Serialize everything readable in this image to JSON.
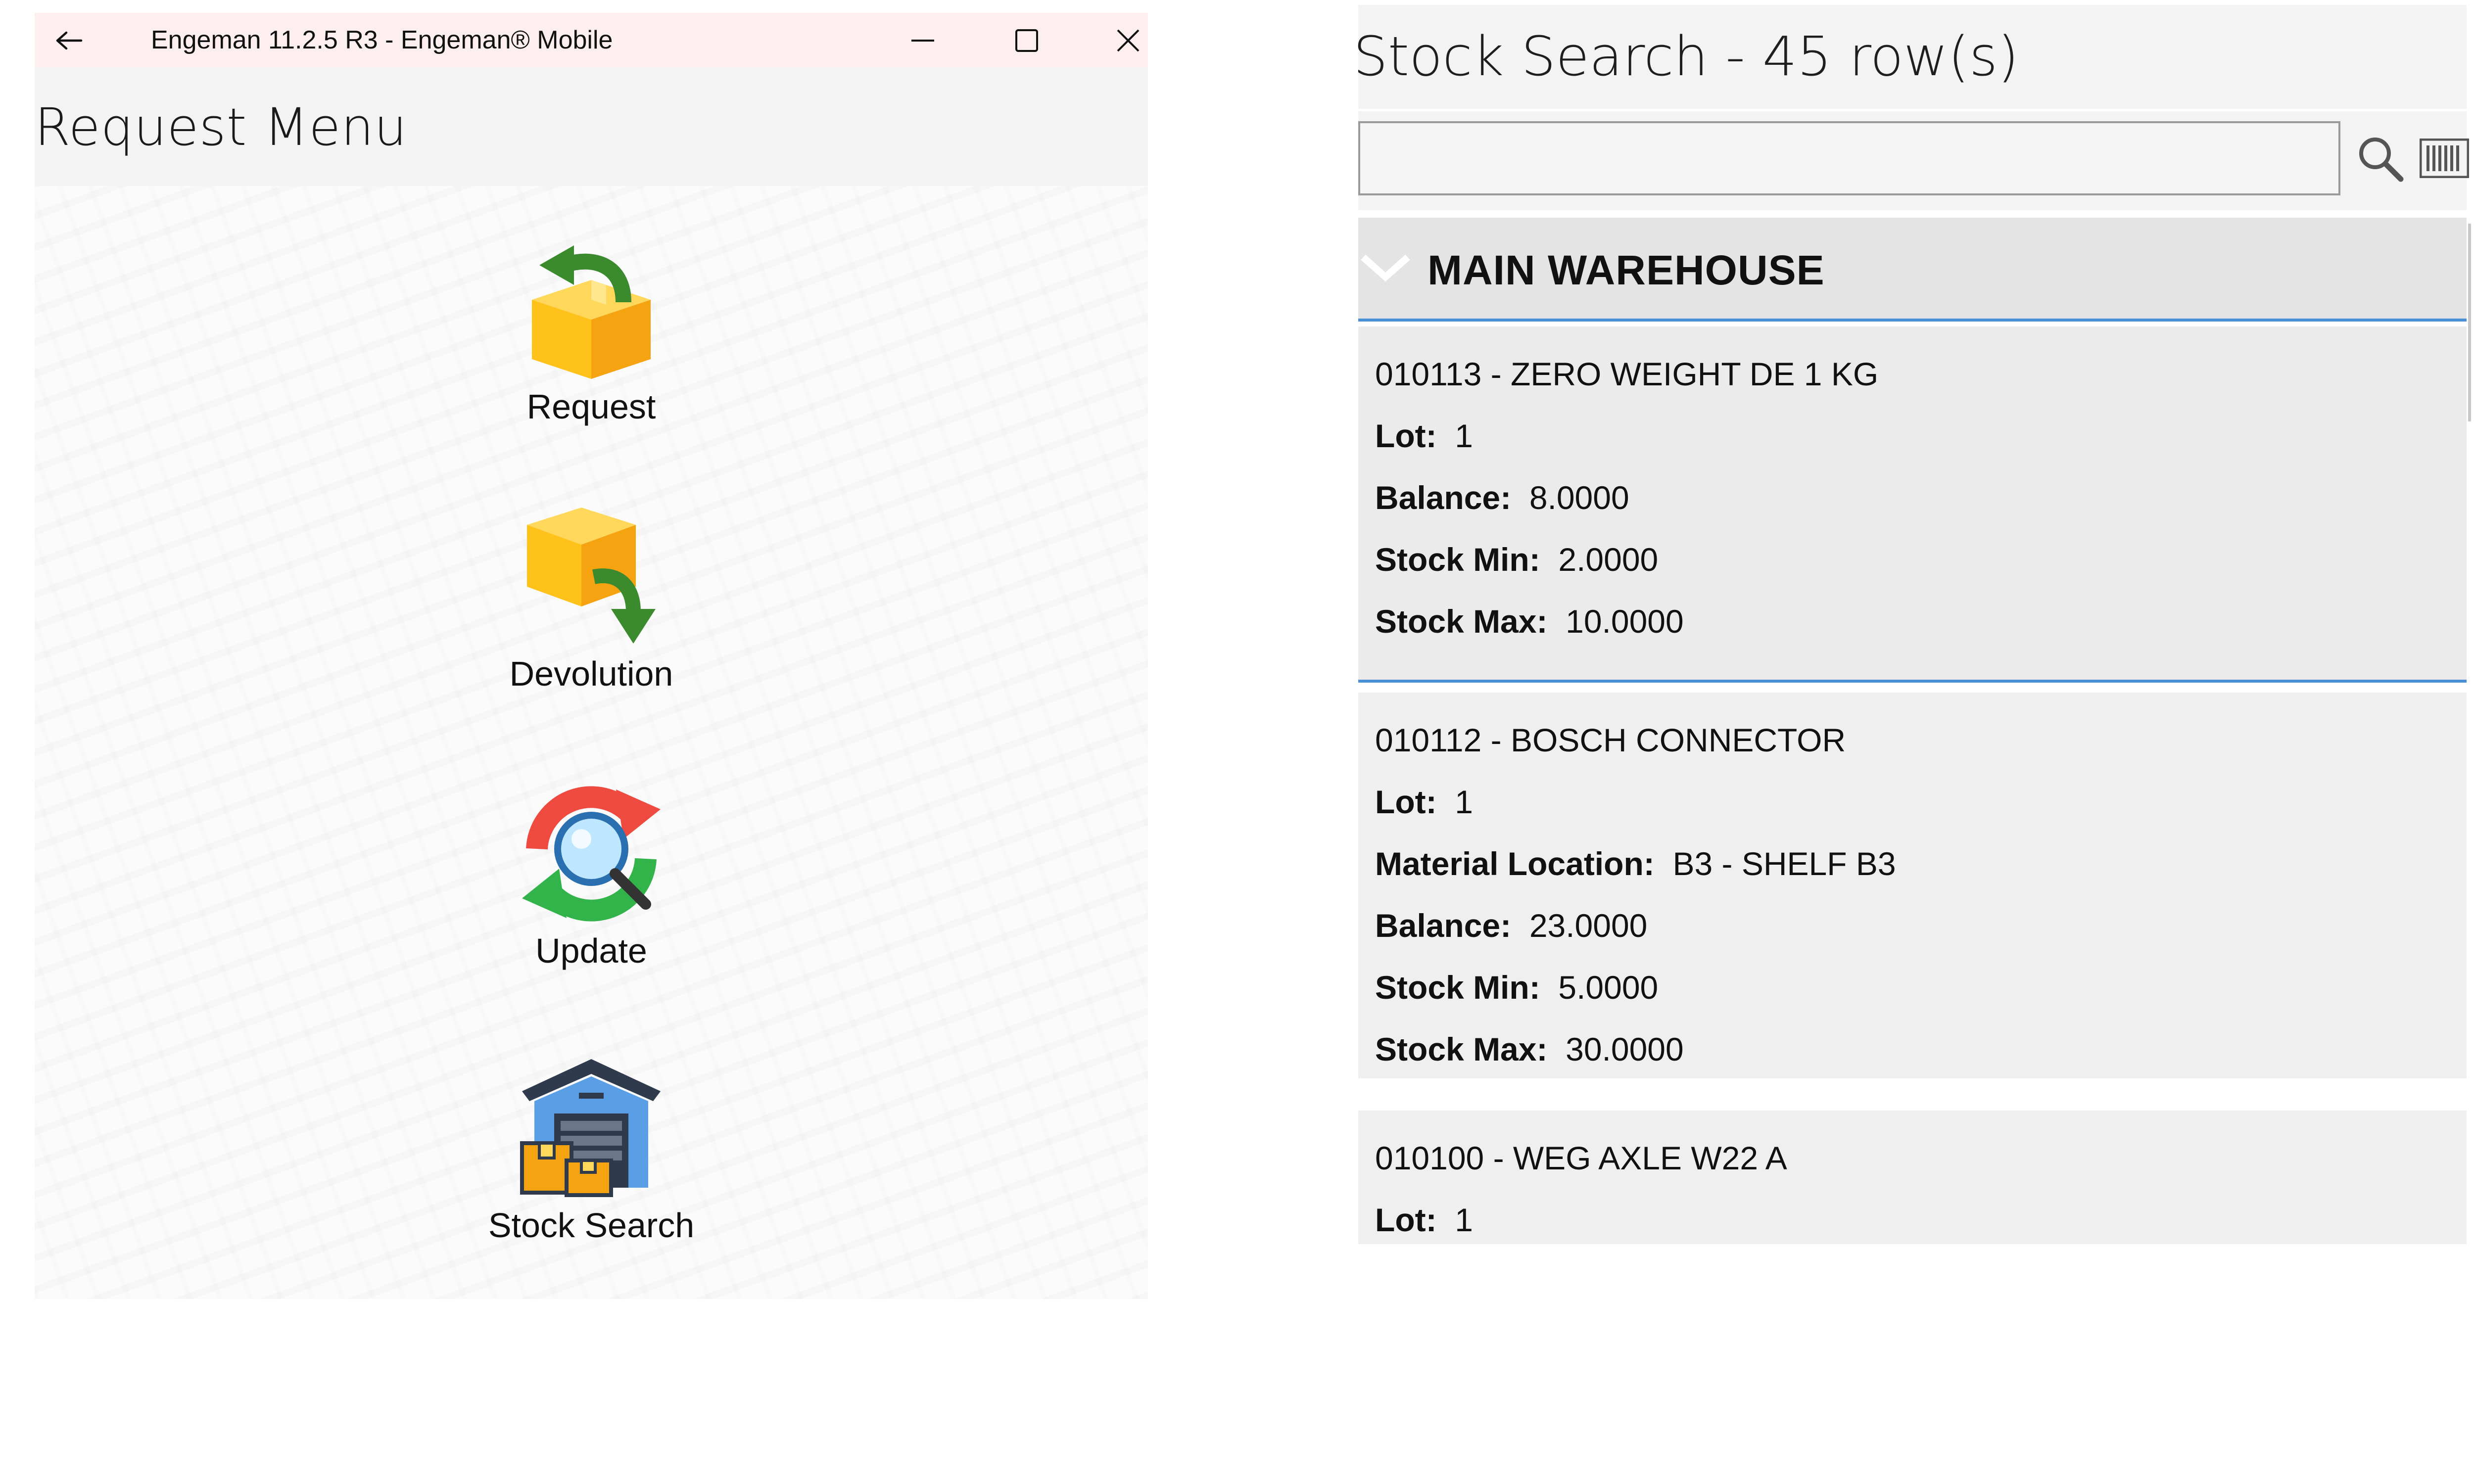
{
  "window": {
    "title": "Engeman 11.2.5 R3 - Engeman® Mobile"
  },
  "request_menu": {
    "heading": "Request Menu",
    "items": [
      {
        "label": "Request",
        "icon": "box-return-arrow-icon"
      },
      {
        "label": "Devolution",
        "icon": "box-down-arrow-icon"
      },
      {
        "label": "Update",
        "icon": "refresh-search-icon"
      },
      {
        "label": "Stock Search",
        "icon": "warehouse-icon"
      }
    ]
  },
  "stock_search": {
    "heading": "Stock Search - 45 row(s)",
    "search": {
      "value": "",
      "placeholder": ""
    },
    "group": {
      "name": "MAIN WAREHOUSE",
      "expanded": true
    },
    "items": [
      {
        "title": "010113 - ZERO WEIGHT DE 1 KG",
        "fields": [
          {
            "label": "Lot:",
            "value": "1"
          },
          {
            "label": "Balance:",
            "value": "8.0000"
          },
          {
            "label": "Stock Min:",
            "value": "2.0000"
          },
          {
            "label": "Stock Max:",
            "value": "10.0000"
          }
        ],
        "selected": true
      },
      {
        "title": "010112 - BOSCH CONNECTOR",
        "fields": [
          {
            "label": "Lot:",
            "value": "1"
          },
          {
            "label": "Material Location:",
            "value": "B3 - SHELF B3"
          },
          {
            "label": "Balance:",
            "value": "23.0000"
          },
          {
            "label": "Stock Min:",
            "value": "5.0000"
          },
          {
            "label": "Stock Max:",
            "value": "30.0000"
          }
        ],
        "selected": false
      },
      {
        "title": "010100 - WEG AXLE W22 A",
        "fields": [
          {
            "label": "Lot:",
            "value": "1"
          }
        ],
        "selected": false
      }
    ]
  },
  "colors": {
    "accent": "#4b8fd6",
    "titlebar_bg": "#fdeff0",
    "card_bg": "#efefef",
    "group_bg": "#e4e4e4"
  }
}
